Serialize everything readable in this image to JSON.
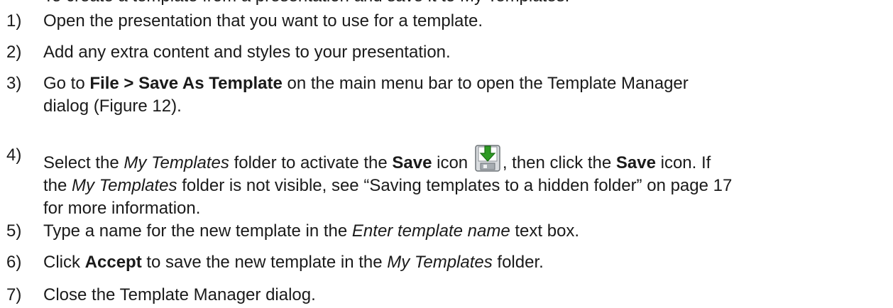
{
  "top_partial": "To create a template from a presentation and save it to My Templates:",
  "steps": [
    {
      "number": "1)",
      "text": "Open the presentation that you want to use for a template."
    },
    {
      "number": "2)",
      "text": "Add any extra content and styles to your presentation."
    },
    {
      "number": "3)",
      "pre": "Go to ",
      "bold": "File > Save As Template",
      "post": " on the main menu bar to open the Template Manager",
      "line2": "dialog (Figure 12)."
    },
    {
      "number": "4)",
      "pre": "Select the ",
      "italic1": "My Templates",
      "mid1": " folder to activate the ",
      "bold1": "Save",
      "mid2": " icon ",
      "icon": "save-template-icon",
      "mid3": ", then click the ",
      "bold2": "Save",
      "post": " icon. If",
      "line2_pre": "the ",
      "line2_italic": "My Templates",
      "line2_post": " folder is not visible, see “Saving templates to a hidden folder” on page 17",
      "line3": "for more information."
    },
    {
      "number": "5)",
      "pre": "Type a name for the new template in the ",
      "italic": "Enter template name",
      "post": " text box."
    },
    {
      "number": "6)",
      "pre": "Click ",
      "bold": "Accept",
      "mid": " to save the new template in the ",
      "italic": "My Templates",
      "post": " folder."
    },
    {
      "number": "7)",
      "text": "Close the Template Manager dialog."
    }
  ],
  "colors": {
    "text": "#1a1a1a",
    "icon_green": "#2f9a24",
    "icon_gray": "#8a8f94"
  }
}
